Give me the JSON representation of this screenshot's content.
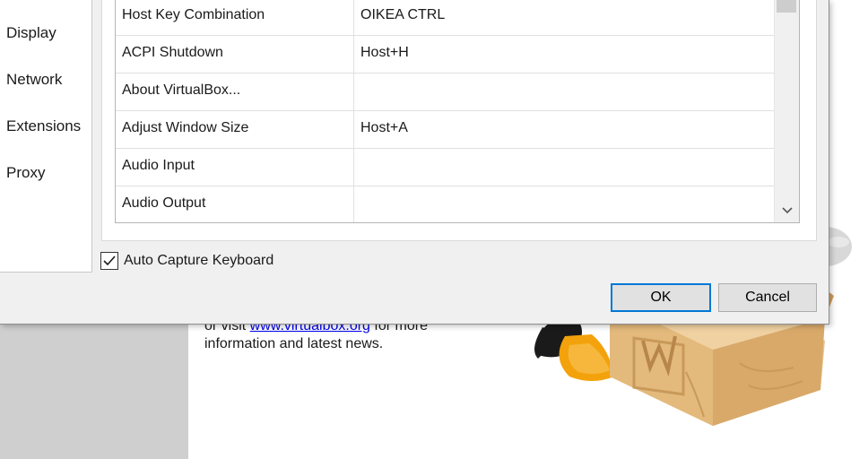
{
  "background": {
    "welcome_prefix": "or visit ",
    "welcome_link": "www.virtualbox.org",
    "welcome_suffix": " for more",
    "welcome_line2": "information and latest news."
  },
  "nav": {
    "items": [
      {
        "label": "Display"
      },
      {
        "label": "Network"
      },
      {
        "label": "Extensions"
      },
      {
        "label": "Proxy"
      }
    ]
  },
  "shortcuts": {
    "rows": [
      {
        "action": "Host Key Combination",
        "shortcut": "OIKEA CTRL"
      },
      {
        "action": "ACPI Shutdown",
        "shortcut": "Host+H"
      },
      {
        "action": "About VirtualBox...",
        "shortcut": ""
      },
      {
        "action": "Adjust Window Size",
        "shortcut": "Host+A"
      },
      {
        "action": "Audio Input",
        "shortcut": ""
      },
      {
        "action": "Audio Output",
        "shortcut": ""
      }
    ]
  },
  "options": {
    "auto_capture_label": "Auto Capture Keyboard",
    "auto_capture_checked": true
  },
  "buttons": {
    "ok": "OK",
    "cancel": "Cancel"
  },
  "colors": {
    "focus_border": "#0078d7",
    "link": "#0000ee"
  }
}
